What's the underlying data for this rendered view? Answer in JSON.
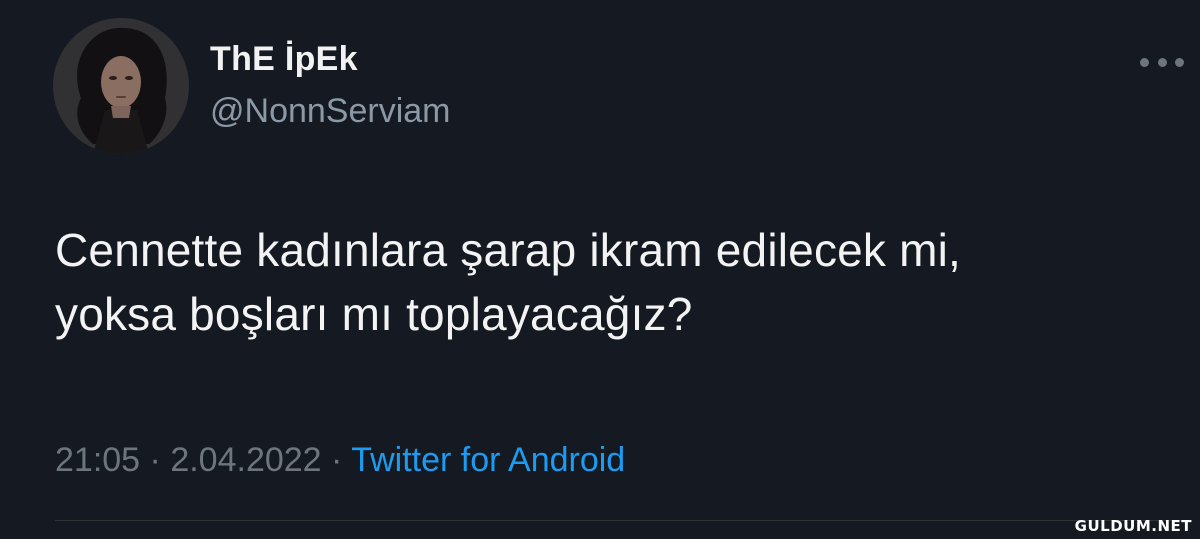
{
  "tweet": {
    "author": {
      "display_name": "ThE İpEk",
      "handle": "@NonnServiam",
      "avatar_icon": "profile-photo"
    },
    "more_icon": "more-options-icon",
    "text_lines": [
      "Cennette kadınlara şarap ikram edilecek mi,",
      "yoksa boşları mı toplayacağız?"
    ],
    "meta": {
      "time": "21:05",
      "separator": "·",
      "date": "2.04.2022",
      "source": "Twitter for Android"
    }
  },
  "watermark": "GULDUM.NET",
  "colors": {
    "background": "#151a22",
    "text": "#f3f3f3",
    "secondary": "#6e767d",
    "link": "#1d9bf0"
  }
}
